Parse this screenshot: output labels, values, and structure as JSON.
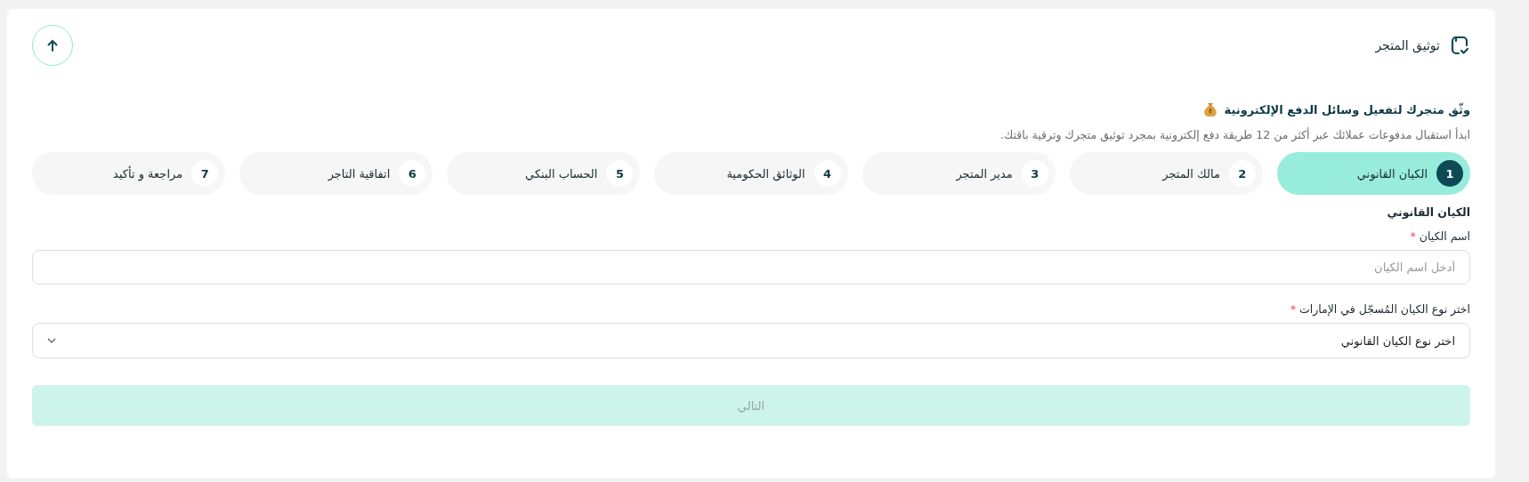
{
  "header": {
    "title": "توثيق المتجر"
  },
  "intro": {
    "heading": "وثّق متجرك لتفعيل وسائل الدفع الإلكترونية",
    "subtitle": "ابدأ استقبال مدفوعات عملائك عبر أكثر من 12 طريقة دفع إلكترونية بمجرد توثيق متجرك وترقية باقتك."
  },
  "steps": [
    {
      "number": "1",
      "label": "الكيان القانوني",
      "selected": true
    },
    {
      "number": "2",
      "label": "مالك المتجر",
      "selected": false
    },
    {
      "number": "3",
      "label": "مدير المتجر",
      "selected": false
    },
    {
      "number": "4",
      "label": "الوثائق الحكومية",
      "selected": false
    },
    {
      "number": "5",
      "label": "الحساب البنكي",
      "selected": false
    },
    {
      "number": "6",
      "label": "اتفاقية التاجر",
      "selected": false
    },
    {
      "number": "7",
      "label": "مراجعة و تأكيد",
      "selected": false
    }
  ],
  "form": {
    "section_title": "الكيان القانوني",
    "fields": [
      {
        "kind": "text",
        "label": "اسم الكيان",
        "required_mark": "*",
        "placeholder": "أدخل اسم الكيان"
      },
      {
        "kind": "select",
        "label": "اختر نوع الكيان المُسجّل في الإمارات",
        "required_mark": "*",
        "value": "اختر نوع الكيان القانوني"
      }
    ],
    "next_button": {
      "label": "التالي",
      "disabled": true
    }
  }
}
